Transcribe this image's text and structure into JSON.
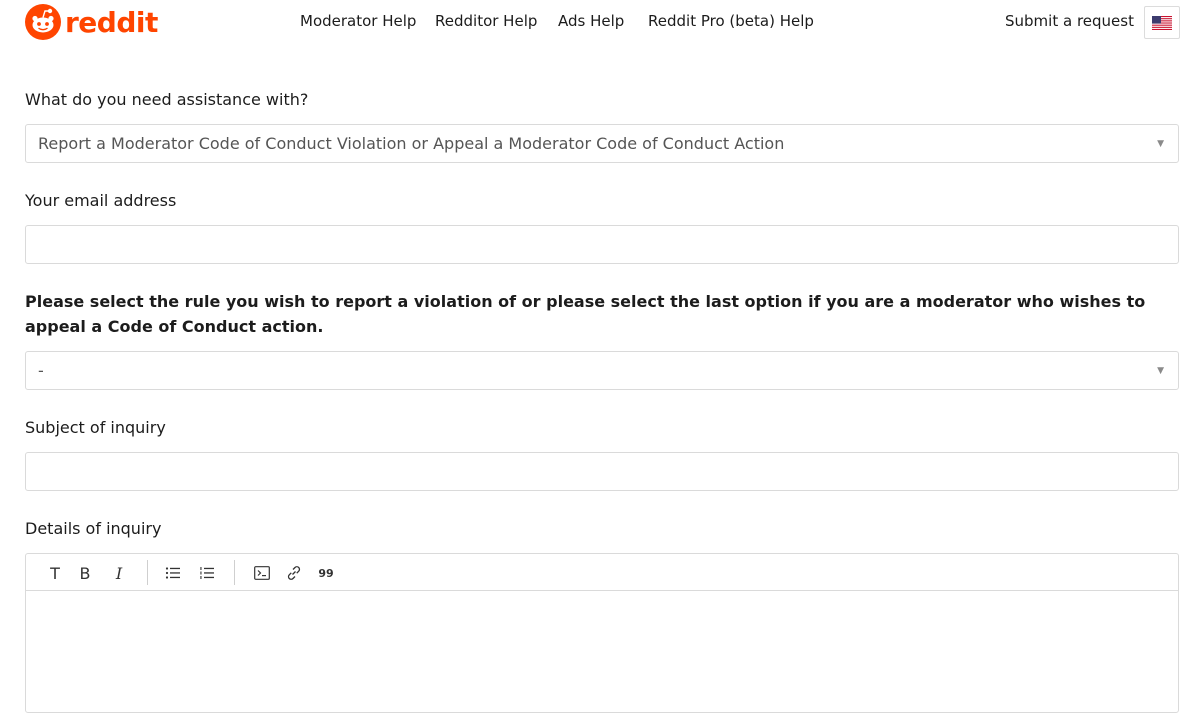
{
  "header": {
    "logo_text": "reddit",
    "nav": [
      "Moderator Help",
      "Redditor Help",
      "Ads Help",
      "Reddit Pro (beta) Help"
    ],
    "submit_request": "Submit a request",
    "language_icon": "us-flag-icon"
  },
  "form": {
    "assistance_label": "What do you need assistance with?",
    "assistance_value": "Report a Moderator Code of Conduct Violation or Appeal a Moderator Code of Conduct Action",
    "email_label": "Your email address",
    "email_value": "",
    "rule_label": "Please select the rule you wish to report a violation of or please select the last option if you are a moderator who wishes to appeal a Code of Conduct action.",
    "rule_value": "-",
    "subject_label": "Subject of inquiry",
    "subject_value": "",
    "details_label": "Details of inquiry",
    "toolbar": {
      "text_glyph": "T",
      "bold_glyph": "B",
      "italic_glyph": "I",
      "quote_glyph": "99"
    }
  },
  "colors": {
    "brand": "#ff4500",
    "border": "#dadada"
  }
}
